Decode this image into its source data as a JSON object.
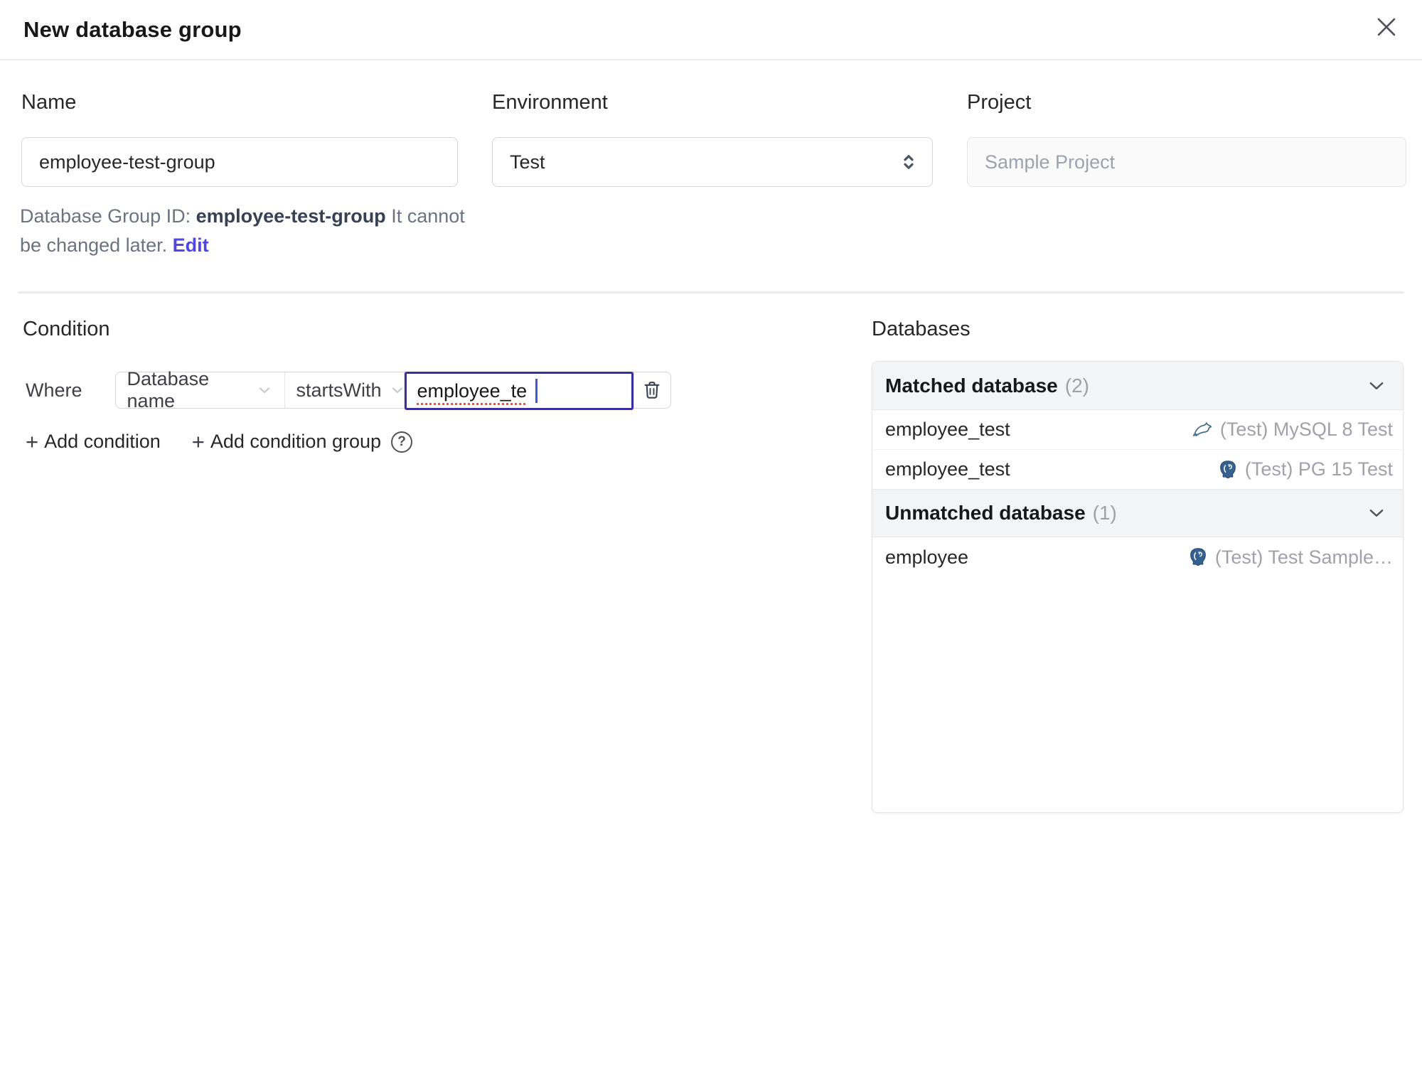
{
  "dialog": {
    "title": "New database group"
  },
  "form": {
    "name": {
      "label": "Name",
      "value": "employee-test-group"
    },
    "environment": {
      "label": "Environment",
      "value": "Test"
    },
    "project": {
      "label": "Project",
      "value": "Sample Project"
    },
    "id_note": {
      "prefix": "Database Group ID: ",
      "id": "employee-test-group",
      "suffix": " It cannot be changed later. ",
      "edit_label": "Edit"
    }
  },
  "condition": {
    "section_title": "Condition",
    "where_label": "Where",
    "factor": "Database name",
    "operator": "startsWith",
    "value": "employee_te",
    "add_condition_label": "Add condition",
    "add_condition_group_label": "Add condition group"
  },
  "databases": {
    "section_title": "Databases",
    "matched": {
      "title": "Matched database",
      "count": "(2)",
      "rows": [
        {
          "name": "employee_test",
          "engine": "mysql-icon",
          "instance": "(Test) MySQL 8 Test"
        },
        {
          "name": "employee_test",
          "engine": "postgres-icon",
          "instance": "(Test) PG 15 Test"
        }
      ]
    },
    "unmatched": {
      "title": "Unmatched database",
      "count": "(1)",
      "rows": [
        {
          "name": "employee",
          "engine": "postgres-icon",
          "instance": "(Test) Test Sample…"
        }
      ]
    }
  },
  "icons": {
    "plus_glyph": "+",
    "help_glyph": "?"
  },
  "colors": {
    "focus_border": "#37309e",
    "caret_blue": "#3b5bdb",
    "spellcheck_red": "#e2574c",
    "edit_link_indigo": "#4f46e5",
    "muted_text": "#a1a1aa",
    "section_header_bg": "#f4f5f6",
    "border_grey": "#d4d4d8",
    "mysql_blue": "#44708e",
    "postgres_blue": "#36618e"
  }
}
